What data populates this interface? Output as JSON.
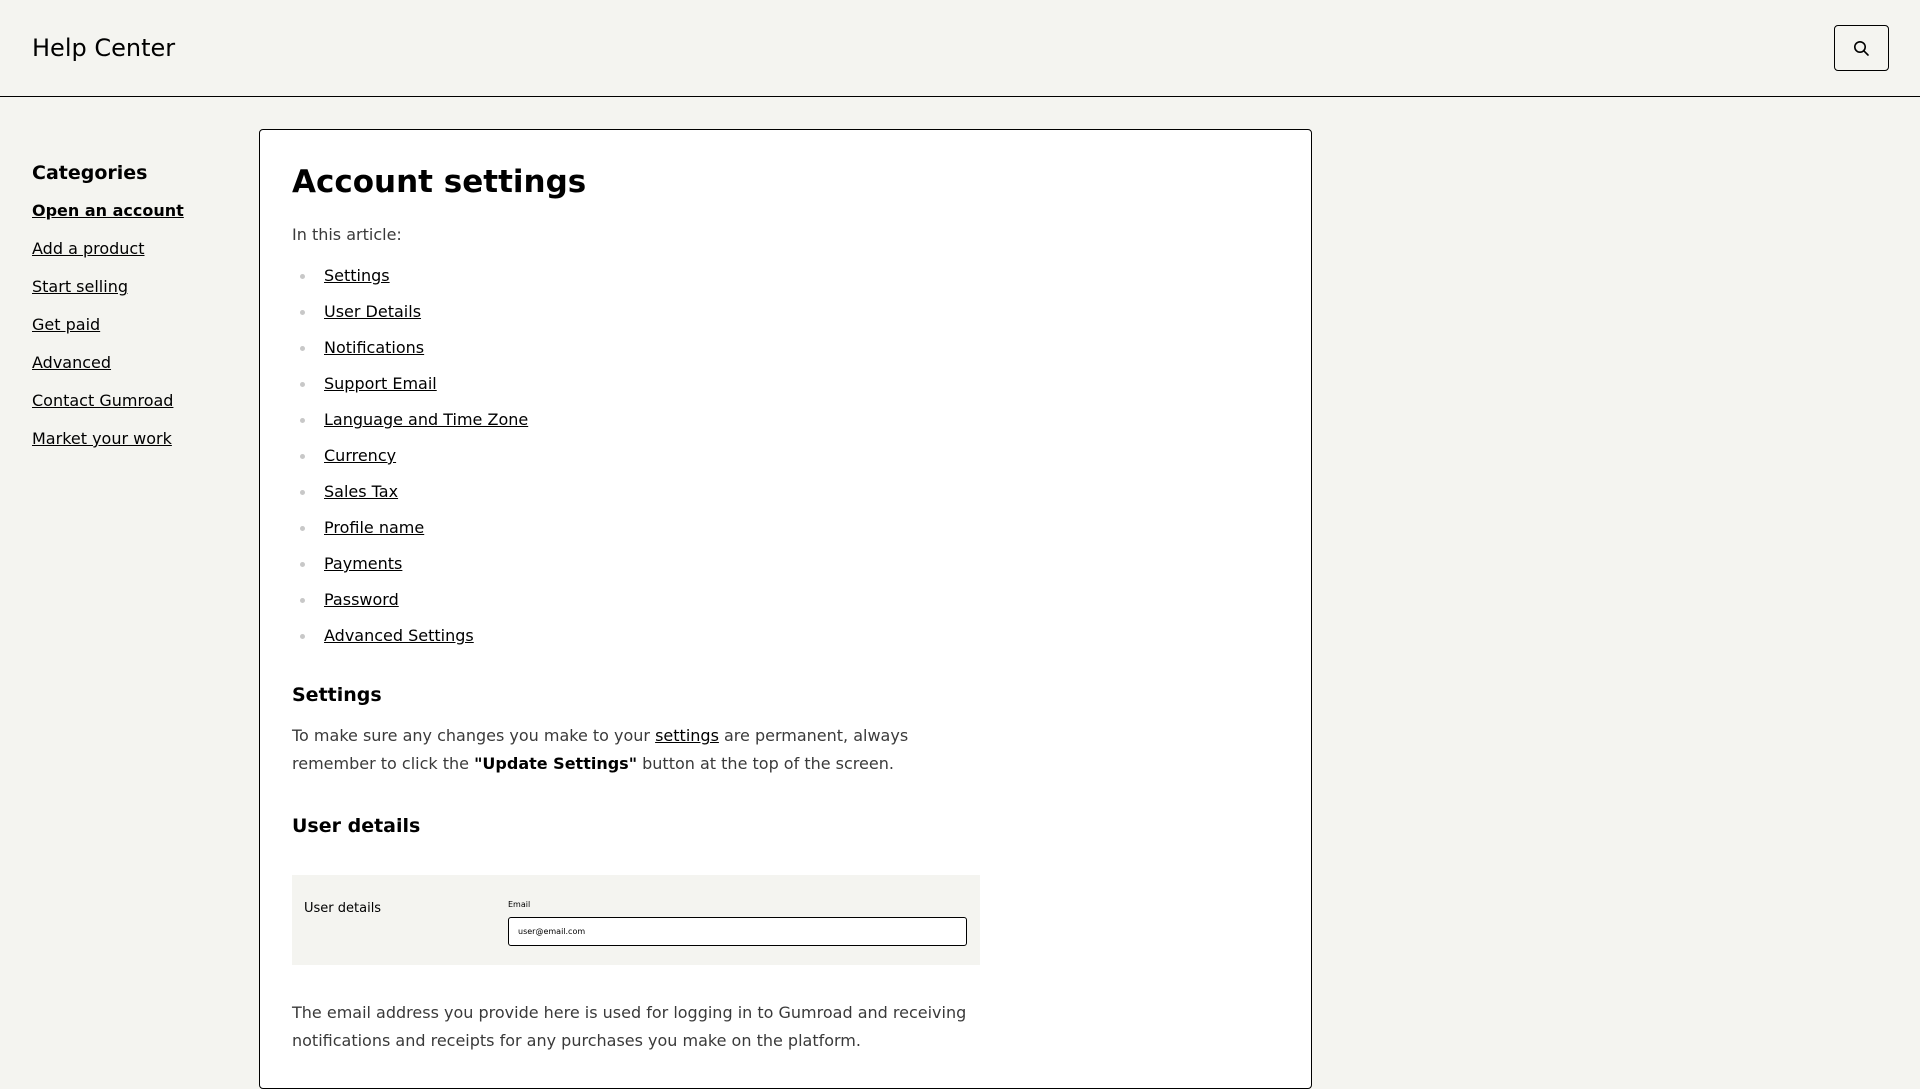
{
  "header": {
    "title": "Help Center",
    "search_icon": "search-icon"
  },
  "sidebar": {
    "heading": "Categories",
    "items": [
      {
        "label": "Open an account",
        "active": true
      },
      {
        "label": "Add a product"
      },
      {
        "label": "Start selling"
      },
      {
        "label": "Get paid"
      },
      {
        "label": "Advanced"
      },
      {
        "label": "Contact Gumroad"
      },
      {
        "label": "Market your work"
      }
    ]
  },
  "article": {
    "title": "Account settings",
    "intro": "In this article:",
    "toc": [
      "Settings",
      "User Details",
      "Notifications",
      "Support Email",
      "Language and Time Zone",
      "Currency",
      "Sales Tax",
      "Profile name",
      "Payments",
      "Password",
      "Advanced Settings"
    ],
    "settings_section": {
      "heading": "Settings",
      "text_before_link": "To make sure any changes you make to your ",
      "link_text": "settings",
      "text_after_link": " are permanent, always remember to click the ",
      "bold_text": "\"Update Settings\"",
      "text_end": " button at the top of the screen."
    },
    "user_details_section": {
      "heading": "User details",
      "figure": {
        "label": "User details",
        "field_label": "Email",
        "field_value": "user@email.com"
      },
      "paragraph": "The email address you provide here is used for logging in to Gumroad and receiving notifications and receipts for any purchases you make on the platform."
    }
  }
}
